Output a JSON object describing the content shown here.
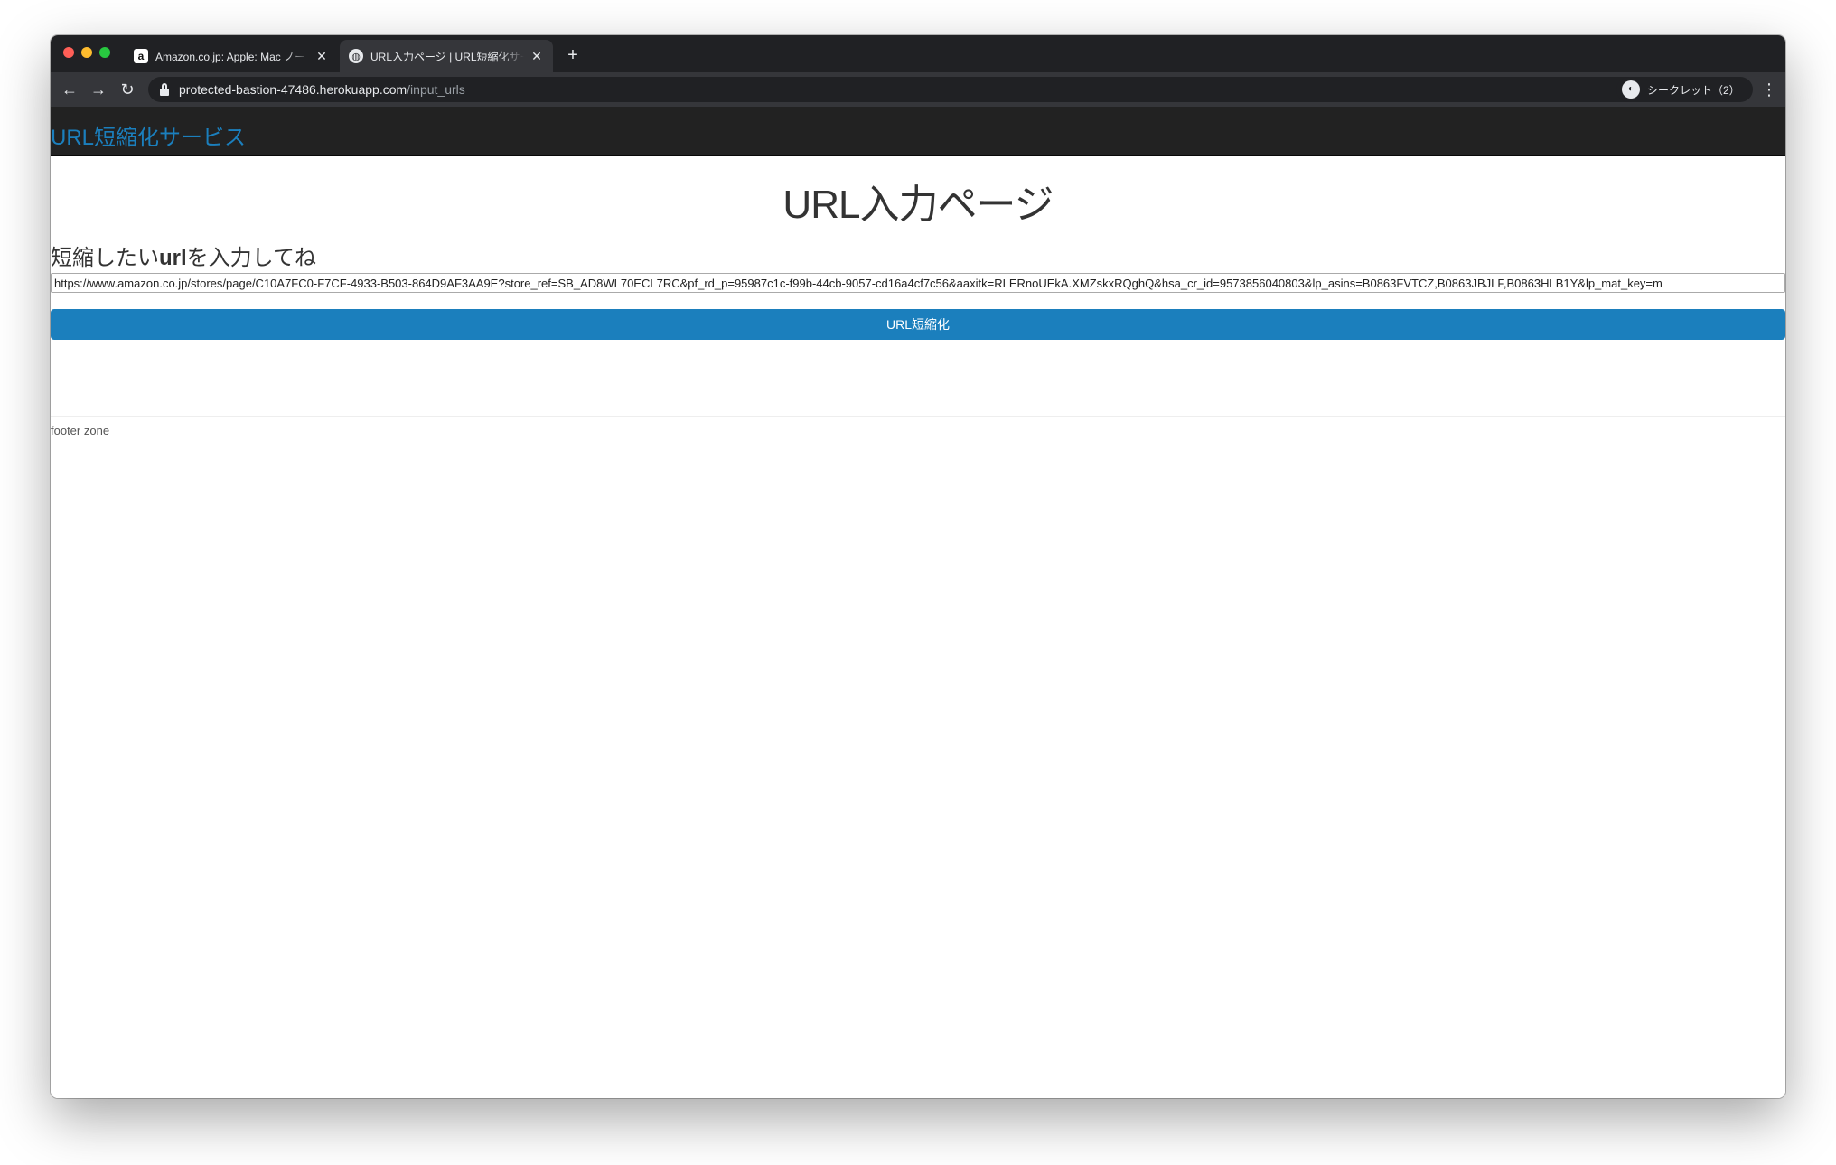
{
  "browser": {
    "tabs": [
      {
        "title": "Amazon.co.jp: Apple: Mac ノート",
        "favicon": "amazon-a-icon",
        "active": false
      },
      {
        "title": "URL入力ページ | URL短縮化サービス",
        "favicon": "globe-icon",
        "active": true
      }
    ],
    "address": {
      "host": "protected-bastion-47486.herokuapp.com",
      "path": "/input_urls"
    },
    "incognito_label": "シークレット（2）"
  },
  "page": {
    "brand": "URL短縮化サービス",
    "title": "URL入力ページ",
    "label_prefix": "短縮したい",
    "label_bold": "url",
    "label_suffix": "を入力してね",
    "url_value": "https://www.amazon.co.jp/stores/page/C10A7FC0-F7CF-4933-B503-864D9AF3AA9E?store_ref=SB_AD8WL70ECL7RC&pf_rd_p=95987c1c-f99b-44cb-9057-cd16a4cf7c56&aaxitk=RLERnoUEkA.XMZskxRQghQ&hsa_cr_id=9573856040803&lp_asins=B0863FVTCZ,B0863JBJLF,B0863HLB1Y&lp_mat_key=m",
    "submit_label": "URL短縮化",
    "footer": "footer zone"
  },
  "colors": {
    "accent": "#1b7fbd",
    "navbar": "#222222",
    "chrome_dark": "#202124",
    "chrome_toolbar": "#35363a"
  }
}
